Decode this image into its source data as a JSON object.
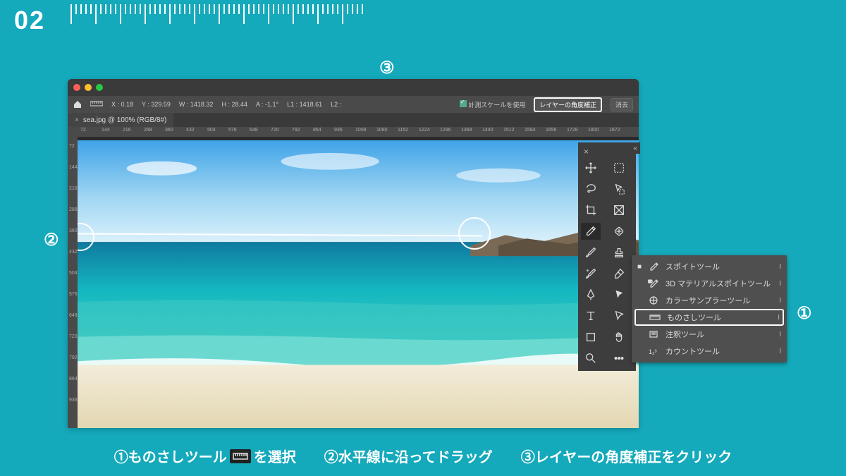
{
  "slide_number": "02",
  "callouts": {
    "c1": "①",
    "c2": "②",
    "c3": "③"
  },
  "optbar": {
    "x": "X : 0.18",
    "y": "Y : 329.59",
    "w": "W : 1418.32",
    "h": "H : 28.44",
    "a": "A : -1.1°",
    "l1": "L1 : 1418.61",
    "l2": "L2 :",
    "use_scale": "計測スケールを使用",
    "straighten": "レイヤーの角度補正",
    "clear": "消去"
  },
  "tab": {
    "close": "×",
    "title": "sea.jpg @ 100% (RGB/8#)"
  },
  "ruler_h_marks": [
    "72",
    "144",
    "216",
    "288",
    "360",
    "432",
    "504",
    "576",
    "648",
    "720",
    "792",
    "864",
    "936",
    "1008",
    "1080",
    "1152",
    "1224",
    "1296",
    "1368",
    "1440",
    "1512",
    "1584",
    "1656",
    "1728",
    "1800",
    "1872"
  ],
  "ruler_v_marks": [
    "72",
    "144",
    "216",
    "288",
    "360",
    "432",
    "504",
    "576",
    "648",
    "720",
    "792",
    "864",
    "936"
  ],
  "flyout": {
    "items": [
      {
        "label": "スポイトツール",
        "shortcut": "I",
        "active": true
      },
      {
        "label": "3D マテリアルスポイトツール",
        "shortcut": "I",
        "active": false
      },
      {
        "label": "カラーサンプラーツール",
        "shortcut": "I",
        "active": false
      },
      {
        "label": "ものさしツール",
        "shortcut": "I",
        "active": false,
        "highlight": true
      },
      {
        "label": "注釈ツール",
        "shortcut": "I",
        "active": false
      },
      {
        "label": "カウントツール",
        "shortcut": "I",
        "active": false
      }
    ]
  },
  "caption": {
    "s1a": "①ものさしツール",
    "s1b": "を選択",
    "s2": "②水平線に沿ってドラッグ",
    "s3": "③レイヤーの角度補正をクリック"
  }
}
